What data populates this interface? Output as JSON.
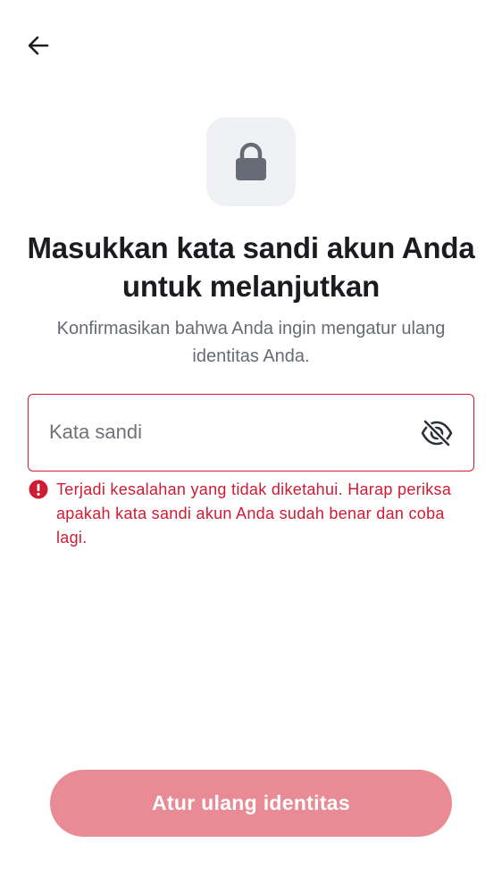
{
  "header": {
    "back_icon": "arrow-left-icon"
  },
  "hero": {
    "icon": "lock-icon",
    "title": "Masukkan kata sandi akun Anda untuk melanjutkan",
    "subtitle": "Konfirmasikan bahwa Anda ingin mengatur ulang identitas Anda."
  },
  "password_field": {
    "value": "",
    "placeholder": "Kata sandi",
    "visibility_icon": "eye-off-icon",
    "error_icon": "alert-circle-icon",
    "error_message": "Terjadi kesalahan yang tidak diketahui. Harap periksa apakah kata sandi akun Anda sudah benar dan coba lagi."
  },
  "actions": {
    "submit_label": "Atur ulang identitas"
  },
  "colors": {
    "error": "#cf1b34",
    "button_disabled": "#e98b95",
    "icon_tile": "#f0f1f5",
    "lock_icon": "#666b75"
  }
}
